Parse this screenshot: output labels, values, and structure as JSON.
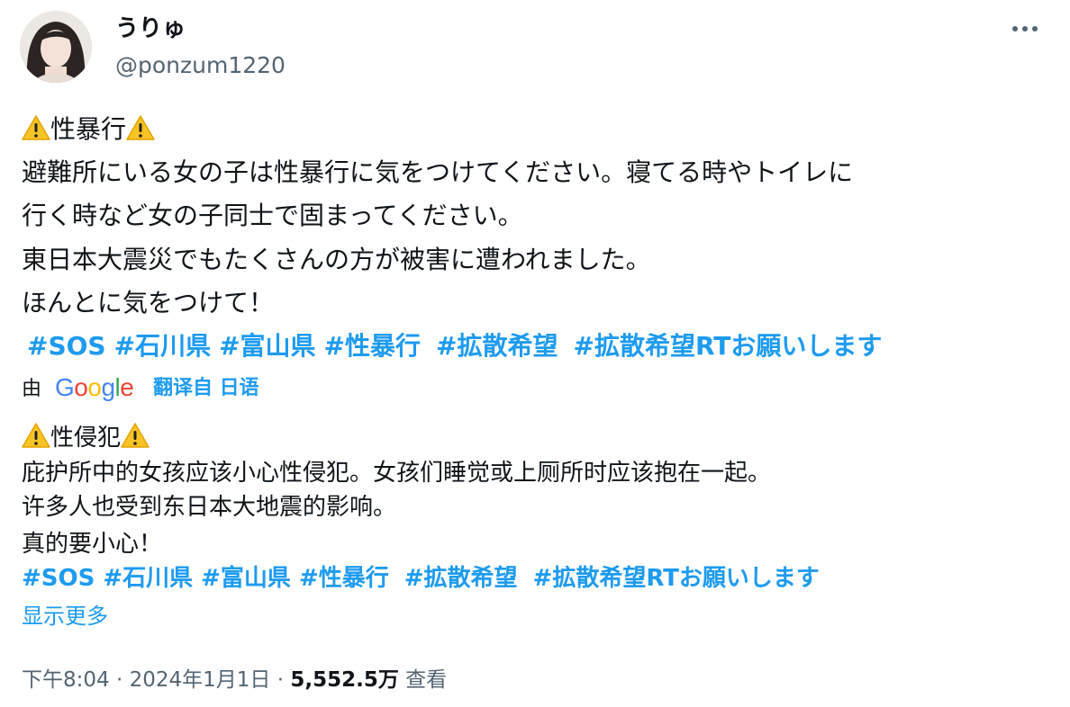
{
  "author": {
    "name": "うりゅ",
    "handle": "@ponzum1220"
  },
  "tweet": {
    "heading_text": "性暴行",
    "lines": [
      "避難所にいる女の子は性暴行に気をつけてください。寝てる時やトイレに",
      "行く時など女の子同士で固まってください。",
      "東日本大震災でもたくさんの方が被害に遭われました。",
      "ほんとに気をつけて！"
    ],
    "hashtags": [
      "#SOS",
      "#石川県",
      "#富山県",
      "#性暴行",
      "#拡散希望",
      "#拡散希望RTお願いします"
    ]
  },
  "translation": {
    "by_label": "由",
    "google_letters": [
      "G",
      "o",
      "o",
      "g",
      "l",
      "e"
    ],
    "google_colors": [
      "#4285f4",
      "#ea4335",
      "#fbbc05",
      "#4285f4",
      "#34a853",
      "#ea4335"
    ],
    "translated_from": "翻译自 日语",
    "heading_text": "性侵犯",
    "lines": [
      "庇护所中的女孩应该小心性侵犯。女孩们睡觉或上厕所时应该抱在一起。",
      "许多人也受到东日本大地震的影响。",
      "真的要小心！"
    ],
    "hashtags": [
      "#SOS",
      "#石川県",
      "#富山県",
      "#性暴行",
      "#拡散希望",
      "#拡散希望RTお願いします"
    ],
    "show_more": "显示更多"
  },
  "meta": {
    "time": "下午8:04",
    "separator": "·",
    "date": "2024年1月1日",
    "views_count": "5,552.5万",
    "views_label": "查看"
  },
  "colors": {
    "link": "#1d9bf0",
    "secondary_text": "#536471",
    "warning_yellow": "#f7c325"
  },
  "icons": [
    "warning-icon",
    "more-icon",
    "google-logo"
  ]
}
